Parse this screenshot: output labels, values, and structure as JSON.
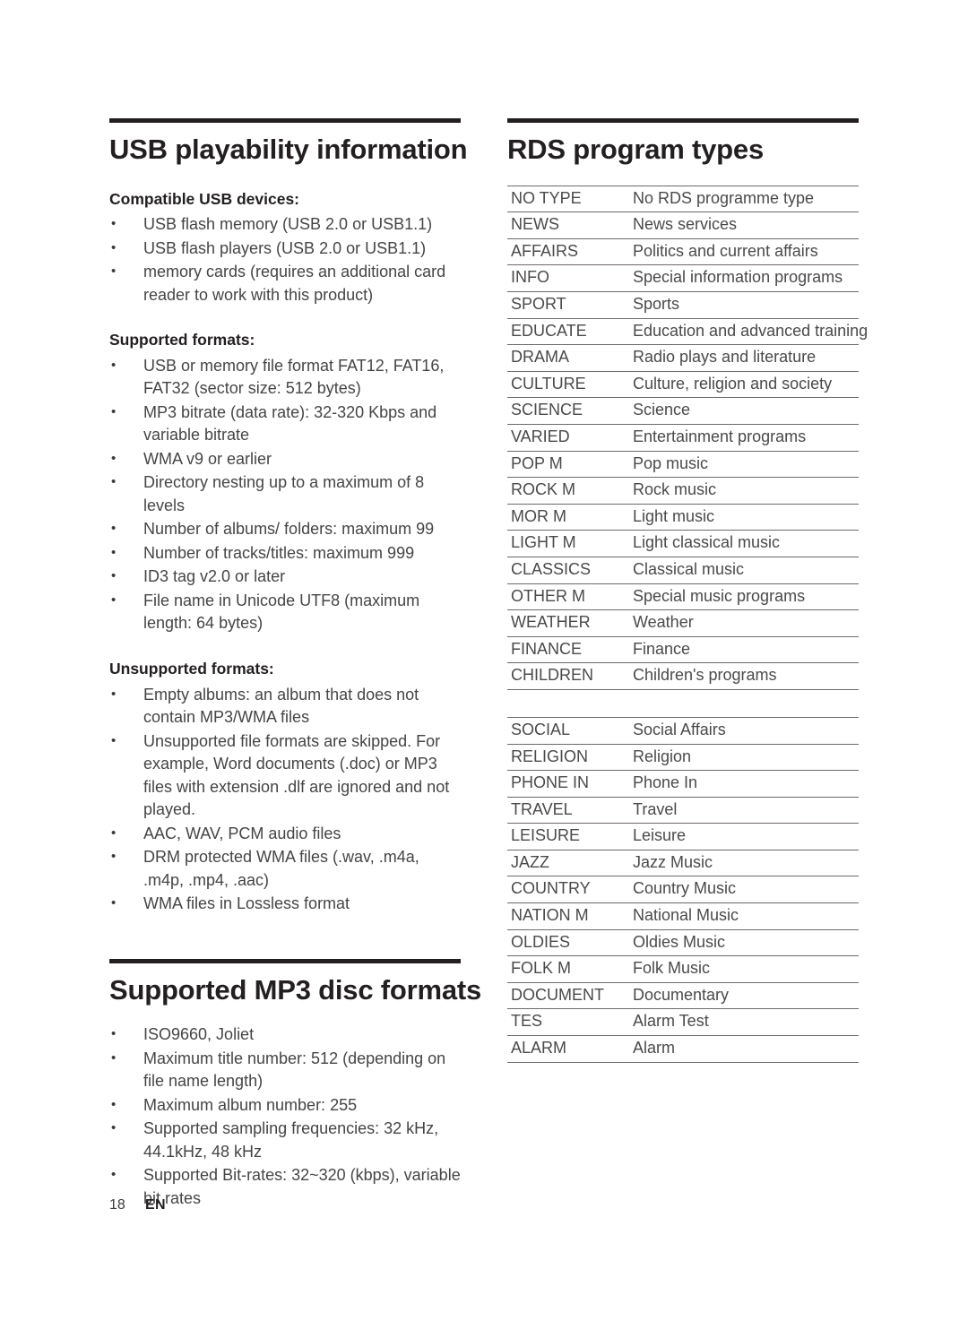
{
  "page": {
    "number": "18",
    "language": "EN"
  },
  "left_column": {
    "usb_section": {
      "title": "USB playability information",
      "groups": [
        {
          "heading_prefix": "Compatible ",
          "heading_strong": "USB",
          "heading_suffix": " devices:",
          "heading_plain": "Compatible USB devices:",
          "items": [
            "USB flash memory (USB 2.0 or USB1.1)",
            "USB flash players (USB 2.0 or USB1.1)",
            "memory cards (requires an additional card reader to work with this product)"
          ]
        },
        {
          "heading_plain": "Supported formats:",
          "items": [
            "USB or memory file format FAT12, FAT16, FAT32 (sector size: 512 bytes)",
            "MP3 bitrate (data rate): 32-320 Kbps and variable bitrate",
            "WMA v9 or earlier",
            "Directory nesting up to a maximum of 8 levels",
            "Number of albums/ folders: maximum 99",
            "Number of tracks/titles: maximum 999",
            "ID3 tag v2.0 or later",
            "File name in Unicode UTF8 (maximum length: 64 bytes)"
          ]
        },
        {
          "heading_plain": "Unsupported formats:",
          "items": [
            "Empty albums: an album that does not contain MP3/WMA files",
            "Unsupported file formats are skipped. For example, Word documents (.doc) or MP3 files with extension .dlf are ignored and not played.",
            "AAC, WAV, PCM audio files",
            "DRM protected WMA files (.wav, .m4a, .m4p, .mp4, .aac)",
            "WMA files in Lossless format"
          ]
        }
      ]
    },
    "mp3_section": {
      "title": "Supported MP3 disc formats",
      "items": [
        "ISO9660, Joliet",
        "Maximum title number: 512 (depending on file name length)",
        "Maximum album number: 255",
        "Supported sampling frequencies: 32 kHz, 44.1kHz, 48 kHz",
        "Supported Bit-rates: 32~320 (kbps), variable bit rates"
      ]
    }
  },
  "right_column": {
    "rds_section": {
      "title": "RDS program types",
      "group_one": [
        {
          "code": "NO TYPE",
          "desc": "No RDS programme type"
        },
        {
          "code": "NEWS",
          "desc": "News services"
        },
        {
          "code": "AFFAIRS",
          "desc": "Politics and current affairs"
        },
        {
          "code": "INFO",
          "desc": "Special information programs"
        },
        {
          "code": "SPORT",
          "desc": "Sports"
        },
        {
          "code": "EDUCATE",
          "desc": "Education and advanced training"
        },
        {
          "code": "DRAMA",
          "desc": "Radio plays and literature"
        },
        {
          "code": "CULTURE",
          "desc": "Culture, religion and society"
        },
        {
          "code": "SCIENCE",
          "desc": "Science"
        },
        {
          "code": "VARIED",
          "desc": "Entertainment programs"
        },
        {
          "code": "POP M",
          "desc": "Pop music"
        },
        {
          "code": "ROCK M",
          "desc": "Rock music"
        },
        {
          "code": "MOR M",
          "desc": "Light music"
        },
        {
          "code": "LIGHT M",
          "desc": "Light classical music"
        },
        {
          "code": "CLASSICS",
          "desc": "Classical music"
        },
        {
          "code": "OTHER M",
          "desc": "Special music programs"
        },
        {
          "code": "WEATHER",
          "desc": "Weather"
        },
        {
          "code": "FINANCE",
          "desc": "Finance"
        },
        {
          "code": "CHILDREN",
          "desc": "Children's programs"
        }
      ],
      "group_two": [
        {
          "code": "SOCIAL",
          "desc": "Social Affairs"
        },
        {
          "code": "RELIGION",
          "desc": "Religion"
        },
        {
          "code": "PHONE IN",
          "desc": "Phone In"
        },
        {
          "code": "TRAVEL",
          "desc": "Travel"
        },
        {
          "code": "LEISURE",
          "desc": "Leisure"
        },
        {
          "code": "JAZZ",
          "desc": "Jazz Music"
        },
        {
          "code": "COUNTRY",
          "desc": "Country Music"
        },
        {
          "code": "NATION M",
          "desc": "National Music"
        },
        {
          "code": "OLDIES",
          "desc": "Oldies Music"
        },
        {
          "code": "FOLK M",
          "desc": "Folk Music"
        },
        {
          "code": "DOCUMENT",
          "desc": "Documentary"
        },
        {
          "code": "TES",
          "desc": "Alarm Test"
        },
        {
          "code": "ALARM",
          "desc": "Alarm"
        }
      ]
    }
  }
}
